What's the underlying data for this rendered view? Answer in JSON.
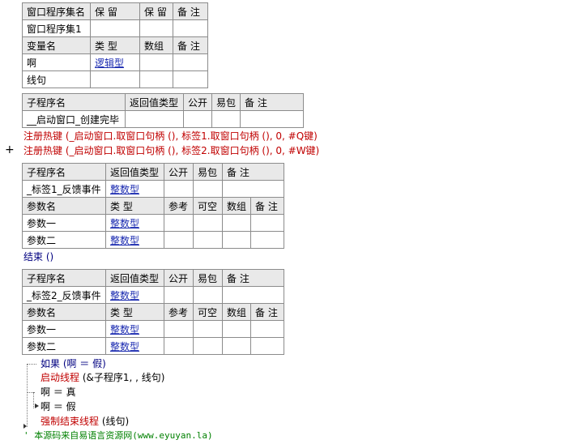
{
  "window_table": {
    "headers": [
      "窗口程序集名",
      "保 留",
      "保 留",
      "备 注"
    ],
    "row": [
      "窗口程序集1",
      "",
      "",
      ""
    ],
    "var_headers": [
      "变量名",
      "类 型",
      "数组",
      "备 注"
    ],
    "vars": [
      {
        "name": "啊",
        "type": "逻辑型"
      },
      {
        "name": "线句",
        "type": ""
      }
    ]
  },
  "sub1": {
    "headers": [
      "子程序名",
      "返回值类型",
      "公开",
      "易包",
      "备 注"
    ],
    "name": "__启动窗口_创建完毕"
  },
  "code_lines": {
    "line1": "注册热键 (_启动窗口.取窗口句柄 (), 标签1.取窗口句柄 (), 0, #Q键)",
    "line2": "注册热键 (_启动窗口.取窗口句柄 (), 标签2.取窗口句柄 (), 0, #W键)",
    "plus": "+"
  },
  "sub2": {
    "headers": [
      "子程序名",
      "返回值类型",
      "公开",
      "易包",
      "备 注"
    ],
    "name": "_标签1_反馈事件",
    "ret": "整数型",
    "param_headers": [
      "参数名",
      "类 型",
      "参考",
      "可空",
      "数组",
      "备 注"
    ],
    "params": [
      {
        "name": "参数一",
        "type": "整数型"
      },
      {
        "name": "参数二",
        "type": "整数型"
      }
    ],
    "end_line": "结束 ()"
  },
  "sub3": {
    "headers": [
      "子程序名",
      "返回值类型",
      "公开",
      "易包",
      "备 注"
    ],
    "name": "_标签2_反馈事件",
    "ret": "整数型",
    "param_headers": [
      "参数名",
      "类 型",
      "参考",
      "可空",
      "数组",
      "备 注"
    ],
    "params": [
      {
        "name": "参数一",
        "type": "整数型"
      },
      {
        "name": "参数二",
        "type": "整数型"
      }
    ]
  },
  "flow": {
    "if_line": "如果 (啊 ＝ 假)",
    "start_thread": "启动线程",
    "start_thread_args": "(&子程序1, , 线句)",
    "assign_true": "啊 ＝ 真",
    "assign_false": "啊 ＝ 假",
    "kill_thread": "强制结束线程",
    "kill_thread_args": "(线句)",
    "comment": "' 本源码来自易语言资源网(www.eyuyan.la)"
  }
}
